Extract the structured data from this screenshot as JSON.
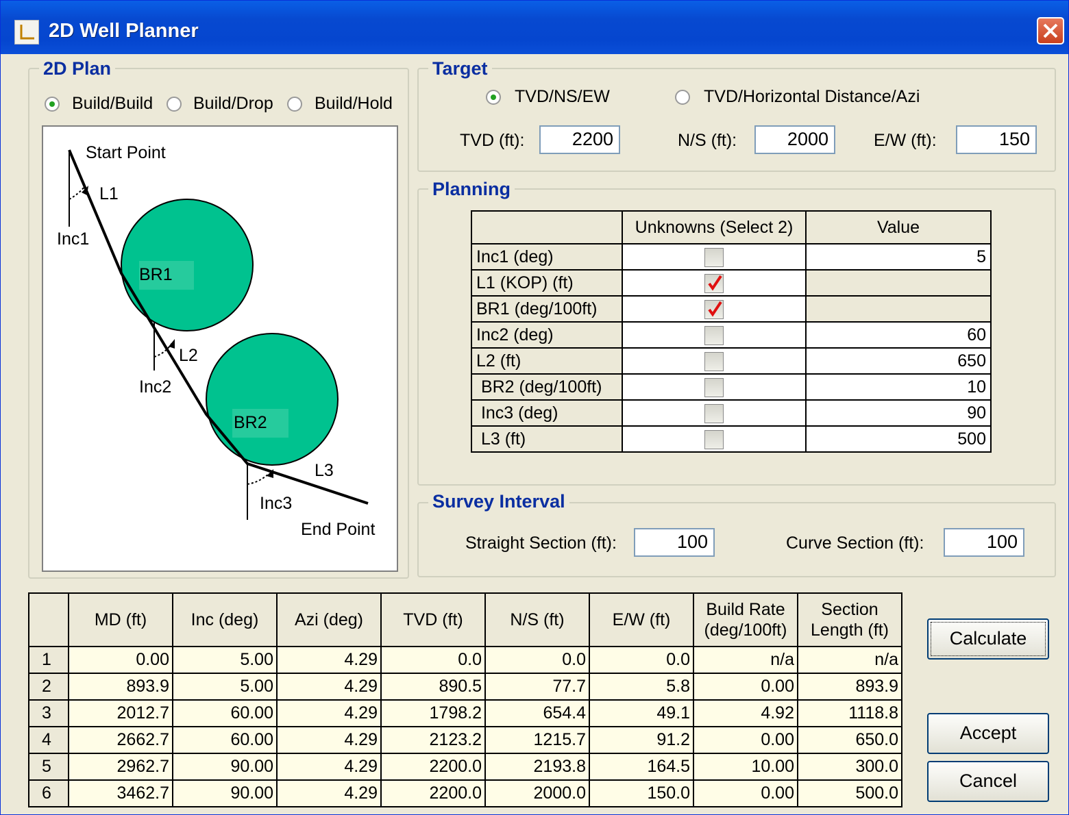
{
  "window": {
    "title": "2D Well Planner"
  },
  "plan": {
    "title": "2D Plan",
    "options": [
      "Build/Build",
      "Build/Drop",
      "Build/Hold"
    ],
    "selected": 0,
    "diagram": {
      "start": "Start Point",
      "end": "End Point",
      "l1": "L1",
      "l2": "L2",
      "l3": "L3",
      "inc1": "Inc1",
      "inc2": "Inc2",
      "inc3": "Inc3",
      "br1": "BR1",
      "br2": "BR2",
      "circle_color": "#00c28f"
    }
  },
  "target": {
    "title": "Target",
    "option1": "TVD/NS/EW",
    "option2": "TVD/Horizontal Distance/Azi",
    "tvd_label": "TVD (ft):",
    "tvd": "2200",
    "ns_label": "N/S (ft):",
    "ns": "2000",
    "ew_label": "E/W (ft):",
    "ew": "150"
  },
  "planning": {
    "title": "Planning",
    "headers": [
      "",
      "Unknowns (Select 2)",
      "Value"
    ],
    "rows": [
      {
        "label": "Inc1 (deg)",
        "checked": false,
        "value": "5"
      },
      {
        "label": "L1 (KOP) (ft)",
        "checked": true,
        "value": ""
      },
      {
        "label": "BR1 (deg/100ft)",
        "checked": true,
        "value": ""
      },
      {
        "label": "Inc2 (deg)",
        "checked": false,
        "value": "60"
      },
      {
        "label": "L2 (ft)",
        "checked": false,
        "value": "650"
      },
      {
        "label": " BR2 (deg/100ft)",
        "checked": false,
        "value": "10"
      },
      {
        "label": " Inc3 (deg)",
        "checked": false,
        "value": "90"
      },
      {
        "label": " L3 (ft)",
        "checked": false,
        "value": "500"
      }
    ]
  },
  "survey": {
    "title": "Survey Interval",
    "straight_label": "Straight Section (ft):",
    "straight": "100",
    "curve_label": "Curve Section (ft):",
    "curve": "100"
  },
  "results": {
    "headers": [
      "MD (ft)",
      "Inc (deg)",
      "Azi (deg)",
      "TVD (ft)",
      "N/S (ft)",
      "E/W (ft)",
      "Build Rate\n(deg/100ft)",
      "Section\nLength (ft)"
    ],
    "rows": [
      {
        "n": "1",
        "cells": [
          "0.00",
          "5.00",
          "4.29",
          "0.0",
          "0.0",
          "0.0",
          "n/a",
          "n/a"
        ]
      },
      {
        "n": "2",
        "cells": [
          "893.9",
          "5.00",
          "4.29",
          "890.5",
          "77.7",
          "5.8",
          "0.00",
          "893.9"
        ]
      },
      {
        "n": "3",
        "cells": [
          "2012.7",
          "60.00",
          "4.29",
          "1798.2",
          "654.4",
          "49.1",
          "4.92",
          "1118.8"
        ]
      },
      {
        "n": "4",
        "cells": [
          "2662.7",
          "60.00",
          "4.29",
          "2123.2",
          "1215.7",
          "91.2",
          "0.00",
          "650.0"
        ]
      },
      {
        "n": "5",
        "cells": [
          "2962.7",
          "90.00",
          "4.29",
          "2200.0",
          "2193.8",
          "164.5",
          "10.00",
          "300.0"
        ]
      },
      {
        "n": "6",
        "cells": [
          "3462.7",
          "90.00",
          "4.29",
          "2200.0",
          "2000.0",
          "150.0",
          "0.00",
          "500.0"
        ]
      }
    ]
  },
  "buttons": {
    "calculate": "Calculate",
    "accept": "Accept",
    "cancel": "Cancel"
  }
}
